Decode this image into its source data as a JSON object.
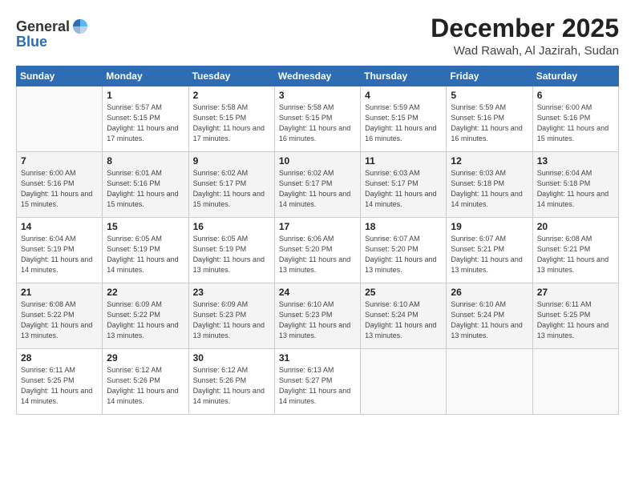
{
  "logo": {
    "general": "General",
    "blue": "Blue"
  },
  "header": {
    "month": "December 2025",
    "location": "Wad Rawah, Al Jazirah, Sudan"
  },
  "days_of_week": [
    "Sunday",
    "Monday",
    "Tuesday",
    "Wednesday",
    "Thursday",
    "Friday",
    "Saturday"
  ],
  "weeks": [
    [
      {
        "day": "",
        "sunrise": "",
        "sunset": "",
        "daylight": ""
      },
      {
        "day": "1",
        "sunrise": "Sunrise: 5:57 AM",
        "sunset": "Sunset: 5:15 PM",
        "daylight": "Daylight: 11 hours and 17 minutes."
      },
      {
        "day": "2",
        "sunrise": "Sunrise: 5:58 AM",
        "sunset": "Sunset: 5:15 PM",
        "daylight": "Daylight: 11 hours and 17 minutes."
      },
      {
        "day": "3",
        "sunrise": "Sunrise: 5:58 AM",
        "sunset": "Sunset: 5:15 PM",
        "daylight": "Daylight: 11 hours and 16 minutes."
      },
      {
        "day": "4",
        "sunrise": "Sunrise: 5:59 AM",
        "sunset": "Sunset: 5:15 PM",
        "daylight": "Daylight: 11 hours and 16 minutes."
      },
      {
        "day": "5",
        "sunrise": "Sunrise: 5:59 AM",
        "sunset": "Sunset: 5:16 PM",
        "daylight": "Daylight: 11 hours and 16 minutes."
      },
      {
        "day": "6",
        "sunrise": "Sunrise: 6:00 AM",
        "sunset": "Sunset: 5:16 PM",
        "daylight": "Daylight: 11 hours and 15 minutes."
      }
    ],
    [
      {
        "day": "7",
        "sunrise": "Sunrise: 6:00 AM",
        "sunset": "Sunset: 5:16 PM",
        "daylight": "Daylight: 11 hours and 15 minutes."
      },
      {
        "day": "8",
        "sunrise": "Sunrise: 6:01 AM",
        "sunset": "Sunset: 5:16 PM",
        "daylight": "Daylight: 11 hours and 15 minutes."
      },
      {
        "day": "9",
        "sunrise": "Sunrise: 6:02 AM",
        "sunset": "Sunset: 5:17 PM",
        "daylight": "Daylight: 11 hours and 15 minutes."
      },
      {
        "day": "10",
        "sunrise": "Sunrise: 6:02 AM",
        "sunset": "Sunset: 5:17 PM",
        "daylight": "Daylight: 11 hours and 14 minutes."
      },
      {
        "day": "11",
        "sunrise": "Sunrise: 6:03 AM",
        "sunset": "Sunset: 5:17 PM",
        "daylight": "Daylight: 11 hours and 14 minutes."
      },
      {
        "day": "12",
        "sunrise": "Sunrise: 6:03 AM",
        "sunset": "Sunset: 5:18 PM",
        "daylight": "Daylight: 11 hours and 14 minutes."
      },
      {
        "day": "13",
        "sunrise": "Sunrise: 6:04 AM",
        "sunset": "Sunset: 5:18 PM",
        "daylight": "Daylight: 11 hours and 14 minutes."
      }
    ],
    [
      {
        "day": "14",
        "sunrise": "Sunrise: 6:04 AM",
        "sunset": "Sunset: 5:19 PM",
        "daylight": "Daylight: 11 hours and 14 minutes."
      },
      {
        "day": "15",
        "sunrise": "Sunrise: 6:05 AM",
        "sunset": "Sunset: 5:19 PM",
        "daylight": "Daylight: 11 hours and 14 minutes."
      },
      {
        "day": "16",
        "sunrise": "Sunrise: 6:05 AM",
        "sunset": "Sunset: 5:19 PM",
        "daylight": "Daylight: 11 hours and 13 minutes."
      },
      {
        "day": "17",
        "sunrise": "Sunrise: 6:06 AM",
        "sunset": "Sunset: 5:20 PM",
        "daylight": "Daylight: 11 hours and 13 minutes."
      },
      {
        "day": "18",
        "sunrise": "Sunrise: 6:07 AM",
        "sunset": "Sunset: 5:20 PM",
        "daylight": "Daylight: 11 hours and 13 minutes."
      },
      {
        "day": "19",
        "sunrise": "Sunrise: 6:07 AM",
        "sunset": "Sunset: 5:21 PM",
        "daylight": "Daylight: 11 hours and 13 minutes."
      },
      {
        "day": "20",
        "sunrise": "Sunrise: 6:08 AM",
        "sunset": "Sunset: 5:21 PM",
        "daylight": "Daylight: 11 hours and 13 minutes."
      }
    ],
    [
      {
        "day": "21",
        "sunrise": "Sunrise: 6:08 AM",
        "sunset": "Sunset: 5:22 PM",
        "daylight": "Daylight: 11 hours and 13 minutes."
      },
      {
        "day": "22",
        "sunrise": "Sunrise: 6:09 AM",
        "sunset": "Sunset: 5:22 PM",
        "daylight": "Daylight: 11 hours and 13 minutes."
      },
      {
        "day": "23",
        "sunrise": "Sunrise: 6:09 AM",
        "sunset": "Sunset: 5:23 PM",
        "daylight": "Daylight: 11 hours and 13 minutes."
      },
      {
        "day": "24",
        "sunrise": "Sunrise: 6:10 AM",
        "sunset": "Sunset: 5:23 PM",
        "daylight": "Daylight: 11 hours and 13 minutes."
      },
      {
        "day": "25",
        "sunrise": "Sunrise: 6:10 AM",
        "sunset": "Sunset: 5:24 PM",
        "daylight": "Daylight: 11 hours and 13 minutes."
      },
      {
        "day": "26",
        "sunrise": "Sunrise: 6:10 AM",
        "sunset": "Sunset: 5:24 PM",
        "daylight": "Daylight: 11 hours and 13 minutes."
      },
      {
        "day": "27",
        "sunrise": "Sunrise: 6:11 AM",
        "sunset": "Sunset: 5:25 PM",
        "daylight": "Daylight: 11 hours and 13 minutes."
      }
    ],
    [
      {
        "day": "28",
        "sunrise": "Sunrise: 6:11 AM",
        "sunset": "Sunset: 5:25 PM",
        "daylight": "Daylight: 11 hours and 14 minutes."
      },
      {
        "day": "29",
        "sunrise": "Sunrise: 6:12 AM",
        "sunset": "Sunset: 5:26 PM",
        "daylight": "Daylight: 11 hours and 14 minutes."
      },
      {
        "day": "30",
        "sunrise": "Sunrise: 6:12 AM",
        "sunset": "Sunset: 5:26 PM",
        "daylight": "Daylight: 11 hours and 14 minutes."
      },
      {
        "day": "31",
        "sunrise": "Sunrise: 6:13 AM",
        "sunset": "Sunset: 5:27 PM",
        "daylight": "Daylight: 11 hours and 14 minutes."
      },
      {
        "day": "",
        "sunrise": "",
        "sunset": "",
        "daylight": ""
      },
      {
        "day": "",
        "sunrise": "",
        "sunset": "",
        "daylight": ""
      },
      {
        "day": "",
        "sunrise": "",
        "sunset": "",
        "daylight": ""
      }
    ]
  ]
}
